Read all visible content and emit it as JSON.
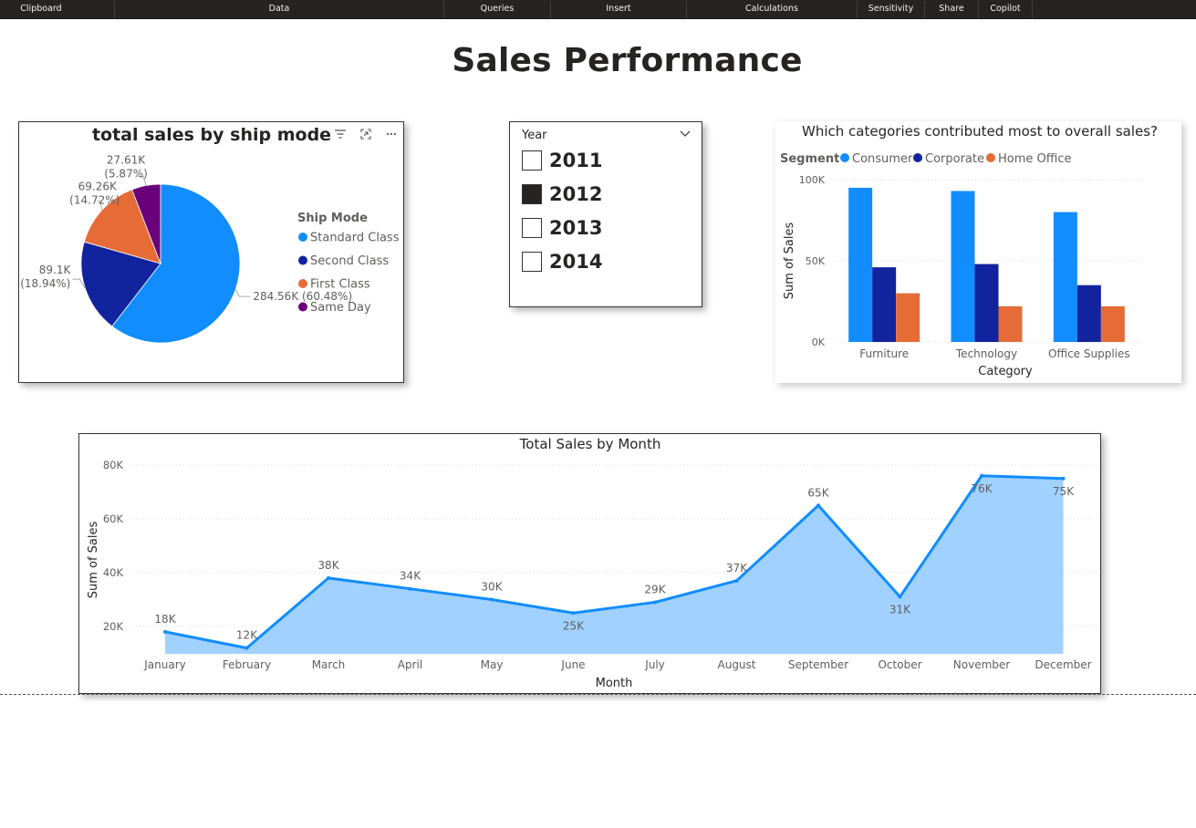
{
  "ribbon": {
    "items": [
      {
        "label": "Clipboard"
      },
      {
        "label": "Data"
      },
      {
        "label": "Queries"
      },
      {
        "label": "Insert"
      },
      {
        "label": "Calculations"
      },
      {
        "label": "Sensitivity"
      },
      {
        "label": "Share"
      },
      {
        "label": "Copilot"
      }
    ]
  },
  "page": {
    "title": "Sales Performance"
  },
  "slicer": {
    "header": "Year",
    "items": [
      {
        "label": "2011",
        "checked": false
      },
      {
        "label": "2012",
        "checked": true
      },
      {
        "label": "2013",
        "checked": false
      },
      {
        "label": "2014",
        "checked": false
      }
    ]
  },
  "chart_data": [
    {
      "type": "pie",
      "title": "total sales by ship mode",
      "legend_title": "Ship Mode",
      "legend_position": "right",
      "slices": [
        {
          "label": "Standard Class",
          "value": 284.56,
          "value_label": "284.56K (60.48%)",
          "color": "#118DFF"
        },
        {
          "label": "Second Class",
          "value": 89.1,
          "value_label": "89.1K",
          "pct_label": "(18.94%)",
          "color": "#12239E"
        },
        {
          "label": "First Class",
          "value": 69.26,
          "value_label": "69.26K",
          "pct_label": "(14.72%)",
          "color": "#E66C37"
        },
        {
          "label": "Same Day",
          "value": 27.61,
          "value_label": "27.61K",
          "pct_label": "(5.87%)",
          "color": "#6B007B"
        }
      ]
    },
    {
      "type": "bar",
      "title": "Which categories contributed most to overall sales?",
      "legend_title": "Segment",
      "legend_position": "top-left",
      "categories": [
        "Furniture",
        "Technology",
        "Office Supplies"
      ],
      "series": [
        {
          "name": "Consumer",
          "values": [
            95,
            93,
            80
          ],
          "color": "#118DFF"
        },
        {
          "name": "Corporate",
          "values": [
            46,
            48,
            35
          ],
          "color": "#12239E"
        },
        {
          "name": "Home Office",
          "values": [
            30,
            22,
            22
          ],
          "color": "#E66C37"
        }
      ],
      "xlabel": "Category",
      "ylabel": "Sum of Sales",
      "ylim": [
        0,
        100
      ],
      "yticks": [
        {
          "v": 0,
          "label": "0K"
        },
        {
          "v": 50,
          "label": "50K"
        },
        {
          "v": 100,
          "label": "100K"
        }
      ],
      "grid": true
    },
    {
      "type": "area",
      "title": "Total Sales by Month",
      "categories": [
        "January",
        "February",
        "March",
        "April",
        "May",
        "June",
        "July",
        "August",
        "September",
        "October",
        "November",
        "December"
      ],
      "values": [
        18,
        12,
        38,
        34,
        30,
        25,
        29,
        37,
        65,
        31,
        76,
        75
      ],
      "data_labels": [
        "18K",
        "12K",
        "38K",
        "34K",
        "30K",
        "25K",
        "29K",
        "37K",
        "65K",
        "31K",
        "76K",
        "75K"
      ],
      "xlabel": "Month",
      "ylabel": "Sum of Sales",
      "ylim": [
        10,
        80
      ],
      "yticks": [
        {
          "v": 20,
          "label": "20K"
        },
        {
          "v": 40,
          "label": "40K"
        },
        {
          "v": 60,
          "label": "60K"
        },
        {
          "v": 80,
          "label": "80K"
        }
      ],
      "grid": true,
      "line_color": "#118DFF",
      "fill_color": "#A0D1FF"
    }
  ]
}
